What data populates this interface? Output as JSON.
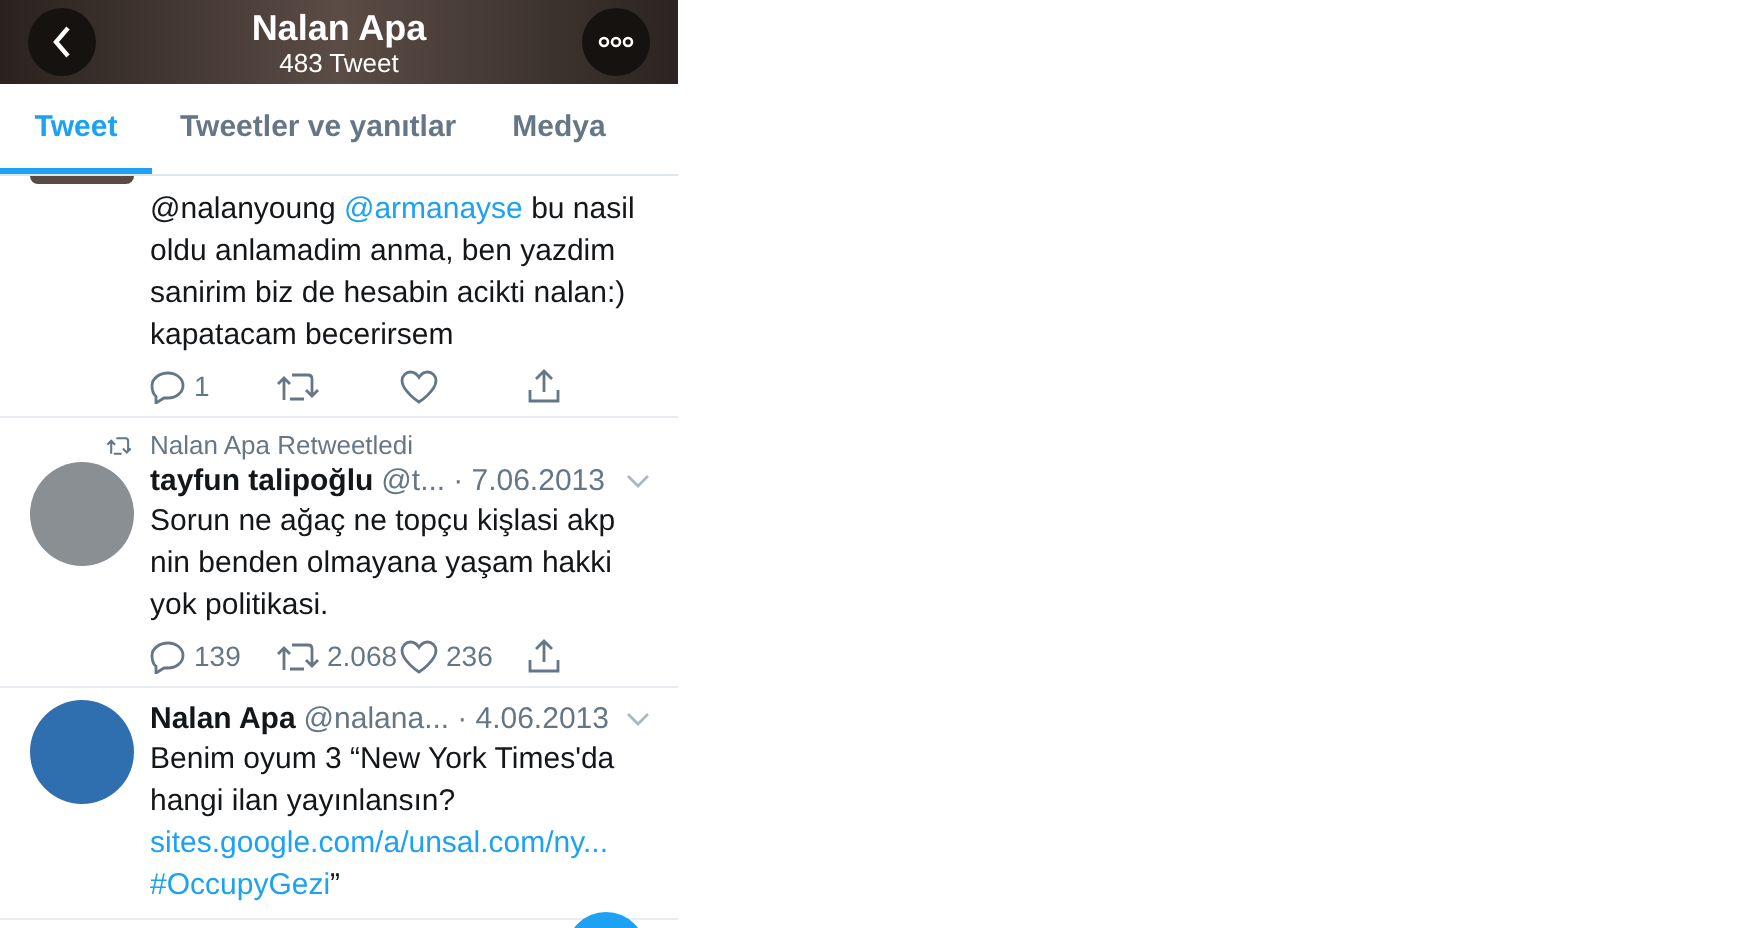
{
  "header": {
    "title": "Nalan Apa",
    "subtitle": "483 Tweet"
  },
  "tabs": [
    {
      "label": "Tweet",
      "selected": true
    },
    {
      "label": "Tweetler ve yanıtlar",
      "selected": false
    },
    {
      "label": "Medya",
      "selected": false
    }
  ],
  "tweets": [
    {
      "partial": true,
      "text": [
        {
          "kind": "text",
          "s": "@nalanyoung "
        },
        {
          "kind": "mention",
          "s": "@armanayse"
        },
        {
          "kind": "text",
          "s": " bu nasil oldu anlamadim anma, ben yazdim sanirim biz de hesabin acikti nalan:) kapatacam becerirsem"
        }
      ],
      "replies": "1"
    },
    {
      "partial": false,
      "retweeted_by": "Nalan Apa Retweetledi",
      "name": "tayfun talipoğlu",
      "handle": "@t...",
      "date": "· 7.06.2013",
      "text": [
        {
          "kind": "text",
          "s": "Sorun ne ağaç ne topçu kişlasi akp nin benden olmayana  yaşam hakki yok politikasi."
        }
      ],
      "replies": "139",
      "retweets": "2.068",
      "likes": "236"
    },
    {
      "partial": false,
      "name": "Nalan Apa",
      "handle": "@nalana...",
      "date": "· 4.06.2013",
      "text": [
        {
          "kind": "text",
          "s": "Benim oyum 3 “New York Times'da hangi ilan yayınlansın? "
        },
        {
          "kind": "link",
          "s": "sites.google.com/a/unsal.com/ny..."
        },
        {
          "kind": "mention",
          "s": "#OccupyGezi"
        },
        {
          "kind": "text",
          "s": "”"
        }
      ]
    }
  ]
}
